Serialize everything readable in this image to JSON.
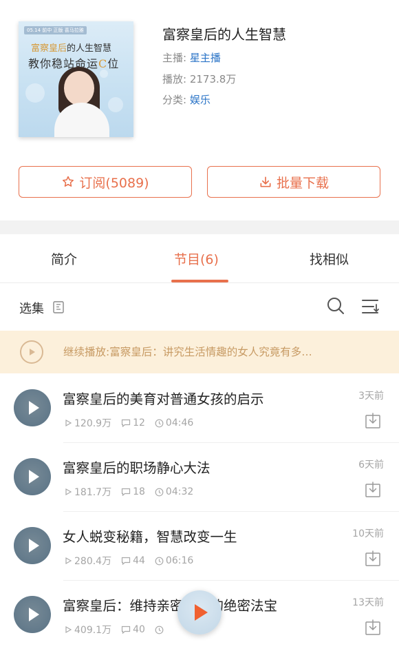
{
  "album": {
    "cover": {
      "tag": "05.14 前中 正版 喜马拉雅",
      "line1_highlight": "富察皇后",
      "line1_rest": "的人生智慧",
      "line2_text": "教你稳站命运",
      "line2_highlight": "C",
      "line2_end": "位"
    },
    "title": "富察皇后的人生智慧",
    "host_label": "主播:",
    "host_value": "星主播",
    "plays_label": "播放:",
    "plays_value": "2173.8万",
    "category_label": "分类:",
    "category_value": "娱乐"
  },
  "actions": {
    "subscribe_label": "订阅(5089)",
    "download_label": "批量下载"
  },
  "tabs": [
    {
      "label": "简介"
    },
    {
      "label": "节目(6)"
    },
    {
      "label": "找相似"
    }
  ],
  "toolbar": {
    "select_label": "选集"
  },
  "resume": {
    "text": "继续播放:富察皇后：讲究生活情趣的女人究竟有多…"
  },
  "episodes": [
    {
      "title": "富察皇后的美育对普通女孩的启示",
      "plays": "120.9万",
      "comments": "12",
      "duration": "04:46",
      "time": "3天前"
    },
    {
      "title": "富察皇后的职场静心大法",
      "plays": "181.7万",
      "comments": "18",
      "duration": "04:32",
      "time": "6天前"
    },
    {
      "title": "女人蜕变秘籍，智慧改变一生",
      "plays": "280.4万",
      "comments": "44",
      "duration": "06:16",
      "time": "10天前"
    },
    {
      "title": "富察皇后：维持亲密关系的绝密法宝",
      "plays": "409.1万",
      "comments": "40",
      "duration": "",
      "time": "13天前"
    }
  ],
  "colors": {
    "accent": "#e8704c",
    "link": "#2b74c7",
    "resume_bg": "#fcf0db",
    "resume_text": "#c79a63"
  }
}
